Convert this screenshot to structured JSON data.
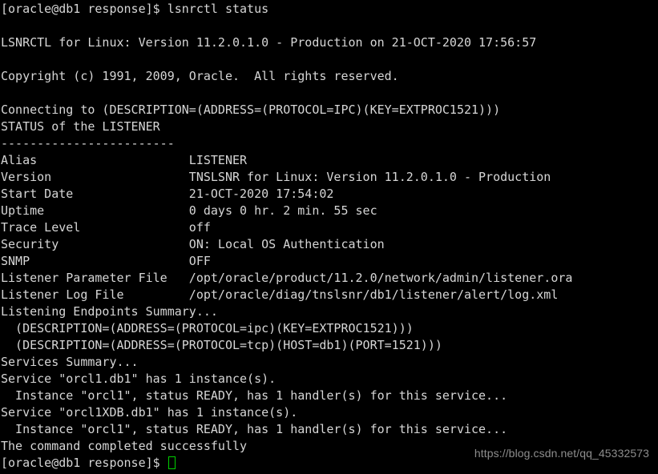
{
  "terminal": {
    "background_color": "#000000",
    "text_color": "#d6d6d6",
    "cursor_color": "#00d000",
    "columns": 85,
    "rows": 28,
    "prompt": "[oracle@db1 response]$",
    "command": "lsnrctl status",
    "lines": [
      "[oracle@db1 response]$ lsnrctl status",
      "",
      "LSNRCTL for Linux: Version 11.2.0.1.0 - Production on 21-OCT-2020 17:56:57",
      "",
      "Copyright (c) 1991, 2009, Oracle.  All rights reserved.",
      "",
      "Connecting to (DESCRIPTION=(ADDRESS=(PROTOCOL=IPC)(KEY=EXTPROC1521)))",
      "STATUS of the LISTENER",
      "------------------------",
      "Alias                     LISTENER",
      "Version                   TNSLSNR for Linux: Version 11.2.0.1.0 - Production",
      "Start Date                21-OCT-2020 17:54:02",
      "Uptime                    0 days 0 hr. 2 min. 55 sec",
      "Trace Level               off",
      "Security                  ON: Local OS Authentication",
      "SNMP                      OFF",
      "Listener Parameter File   /opt/oracle/product/11.2.0/network/admin/listener.ora",
      "Listener Log File         /opt/oracle/diag/tnslsnr/db1/listener/alert/log.xml",
      "Listening Endpoints Summary...",
      "  (DESCRIPTION=(ADDRESS=(PROTOCOL=ipc)(KEY=EXTPROC1521)))",
      "  (DESCRIPTION=(ADDRESS=(PROTOCOL=tcp)(HOST=db1)(PORT=1521)))",
      "Services Summary...",
      "Service \"orcl1.db1\" has 1 instance(s).",
      "  Instance \"orcl1\", status READY, has 1 handler(s) for this service...",
      "Service \"orcl1XDB.db1\" has 1 instance(s).",
      "  Instance \"orcl1\", status READY, has 1 handler(s) for this service...",
      "The command completed successfully"
    ],
    "final_prompt": "[oracle@db1 response]$ ",
    "listener_status": {
      "alias": "LISTENER",
      "version": "TNSLSNR for Linux: Version 11.2.0.1.0 - Production",
      "start_date": "21-OCT-2020 17:54:02",
      "uptime": "0 days 0 hr. 2 min. 55 sec",
      "trace_level": "off",
      "security": "ON: Local OS Authentication",
      "snmp": "OFF",
      "listener_parameter_file": "/opt/oracle/product/11.2.0/network/admin/listener.ora",
      "listener_log_file": "/opt/oracle/diag/tnslsnr/db1/listener/alert/log.xml"
    }
  },
  "watermark": {
    "text": "https://blog.csdn.net/qq_45332573",
    "color": "#8d8d8d"
  }
}
